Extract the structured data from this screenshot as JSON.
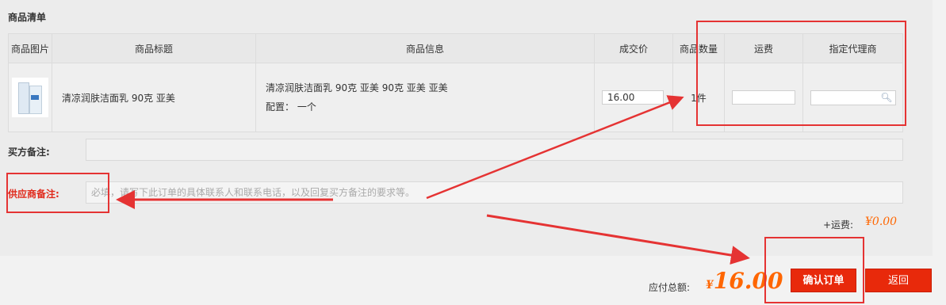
{
  "section_title": "商品清单",
  "table": {
    "headers": [
      "商品图片",
      "商品标题",
      "商品信息",
      "成交价",
      "商品数量",
      "运费",
      "指定代理商"
    ],
    "row": {
      "title": "清凉润肤洁面乳 90克 亚美",
      "info": "清凉润肤洁面乳 90克 亚美   90克   亚美   亚美",
      "config": "配置：  一个",
      "price": "16.00",
      "quantity": "1件",
      "freight": "",
      "agent": ""
    }
  },
  "buyer_note": {
    "label": "买方备注:",
    "value": ""
  },
  "supplier_note": {
    "label": "供应商备注:",
    "placeholder": "必填，请写下此订单的具体联系人和联系电话，以及回复买方备注的要求等。"
  },
  "shipping": {
    "label": "+运费:",
    "value": "¥0.00"
  },
  "total": {
    "label": "应付总额:",
    "currency": "¥",
    "value": "16.00"
  },
  "buttons": {
    "confirm": "确认订单",
    "back": "返回"
  },
  "colors": {
    "accent": "#ff6600",
    "button": "#e8290b",
    "annotation": "#e53333"
  }
}
